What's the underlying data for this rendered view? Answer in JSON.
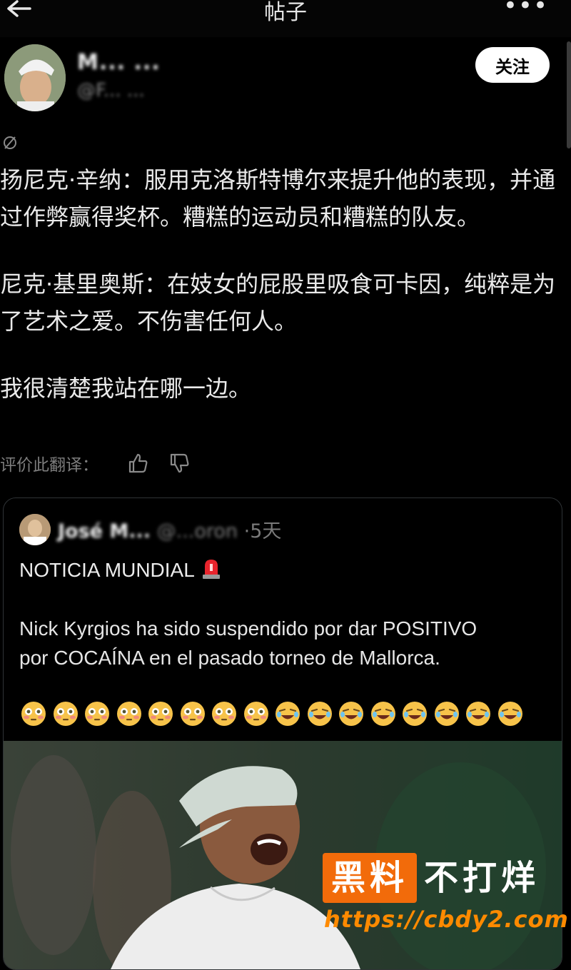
{
  "header": {
    "title": "帖子",
    "back_icon": "arrow-left-icon",
    "more_label": "•••"
  },
  "author": {
    "name": "M... ...",
    "handle": "@F... ...",
    "follow_label": "关注"
  },
  "post": {
    "globe_icon": "globe-icon",
    "translated_paragraphs": [
      "扬尼克·辛纳：服用克洛斯特博尔来提升他的表现，并通过作弊赢得奖杯。糟糕的运动员和糟糕的队友。",
      "尼克·基里奥斯：在妓女的屁股里吸食可卡因，纯粹是为了艺术之爱。不伤害任何人。",
      "我很清楚我站在哪一边。"
    ],
    "rate_label": "评价此翻译：",
    "thumb_up_icon": "thumbs-up-icon",
    "thumb_down_icon": "thumbs-down-icon"
  },
  "quoted": {
    "name": "José M...",
    "handle": "@...oron",
    "time": "·5天",
    "headline": "NOTICIA MUNDIAL",
    "siren_icon": "police-light-emoji",
    "body_lines": [
      "Nick Kyrgios ha sido suspendido por dar POSITIVO",
      "por COCAÍNA en el pasado torneo de Mallorca."
    ],
    "emojis": [
      "flushed",
      "flushed",
      "flushed",
      "flushed",
      "flushed",
      "flushed",
      "flushed",
      "flushed",
      "rofl",
      "rofl",
      "rofl",
      "rofl",
      "rofl",
      "rofl",
      "rofl",
      "rofl"
    ]
  },
  "watermark": {
    "box_text": "黑料",
    "text": "不打烊",
    "url": "https://cbdy2.com"
  },
  "colors": {
    "background": "#000000",
    "accent": "#f26b0a",
    "url": "#ff8a00",
    "border": "#2f3336"
  }
}
